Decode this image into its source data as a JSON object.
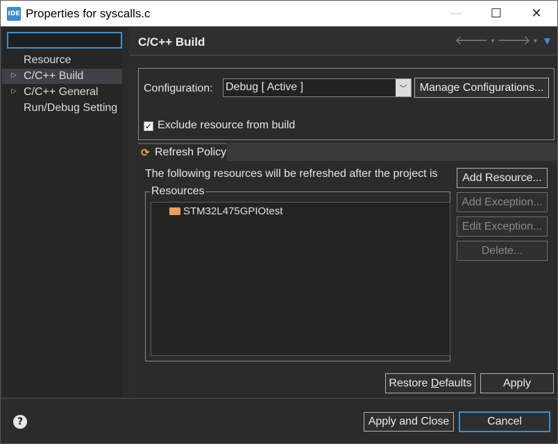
{
  "window": {
    "title": "Properties for syscalls.c",
    "app_icon_text": "IDE",
    "minimize_glyph": "—",
    "maximize_glyph": "☐",
    "close_glyph": "✕"
  },
  "filter": {
    "value": "",
    "placeholder": ""
  },
  "tree": {
    "items": [
      {
        "label": "Resource",
        "expandable": false,
        "selected": false
      },
      {
        "label": "C/C++ Build",
        "expandable": true,
        "selected": true
      },
      {
        "label": "C/C++ General",
        "expandable": true,
        "selected": false
      },
      {
        "label": "Run/Debug Setting",
        "expandable": false,
        "selected": false
      }
    ]
  },
  "page": {
    "title": "C/C++ Build",
    "nav": {
      "back": "🡐",
      "forward": "🡒",
      "dropdown": "▾",
      "menu": "▼"
    }
  },
  "configuration": {
    "label": "Configuration:",
    "selected": "Debug  [ Active ]",
    "manage_button": "Manage Configurations..."
  },
  "exclude": {
    "label": "Exclude resource from build",
    "checked": true
  },
  "tabs": [
    {
      "label": "Refresh Policy",
      "icon": "refresh-icon",
      "active": true
    }
  ],
  "refresh": {
    "description": "The following resources will be refreshed after the project is",
    "group_label": "Resources",
    "resources": [
      {
        "name": "STM32L475GPIOtest",
        "icon": "folder-open-icon"
      }
    ],
    "buttons": {
      "add_resource": "Add Resource...",
      "add_exception": "Add Exception...",
      "edit_exception": "Edit Exception...",
      "delete": "Delete..."
    }
  },
  "actions": {
    "restore_prefix": "Restore ",
    "restore_accel": "D",
    "restore_suffix": "efaults",
    "apply": "Apply",
    "apply_and_close": "Apply and Close",
    "cancel": "Cancel",
    "help": "?"
  },
  "colors": {
    "accent": "#3d8fd6",
    "background": "#2b2b2b",
    "selection": "#3f4146",
    "folder": "#e8a15a",
    "refresh_icon": "#f0b030"
  }
}
